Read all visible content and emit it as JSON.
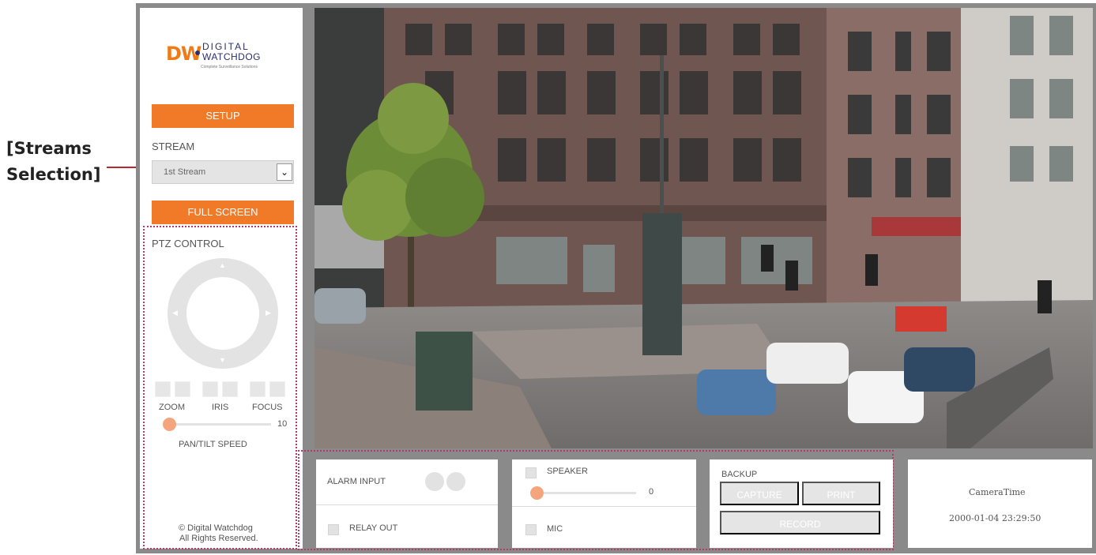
{
  "annotation": {
    "line1": "[Streams",
    "line2": "Selection]"
  },
  "logo": {
    "brand_mark": "DW",
    "name_top": "DIGITAL",
    "name_bottom": "WATCHDOG",
    "tagline": "Complete Surveillance Solutions"
  },
  "sidebar": {
    "setup_label": "SETUP",
    "stream_label": "STREAM",
    "stream_selected": "1st Stream",
    "fullscreen_label": "FULL SCREEN",
    "ptz_title": "PTZ CONTROL",
    "zoom_label": "ZOOM",
    "iris_label": "IRIS",
    "focus_label": "FOCUS",
    "speed_value": "10",
    "speed_label": "PAN/TILT SPEED",
    "copyright": "© Digital Watchdog",
    "rights": "All Rights Reserved."
  },
  "bottom": {
    "alarm_input_label": "ALARM INPUT",
    "relay_out_label": "RELAY OUT",
    "speaker_label": "SPEAKER",
    "speaker_value": "0",
    "mic_label": "MIC",
    "backup_label": "BACKUP",
    "capture_label": "CAPTURE",
    "print_label": "PRINT",
    "record_label": "RECORD",
    "camera_time_label": "CameraTime",
    "camera_time_value": "2000-01-04 23:29:50"
  },
  "colors": {
    "accent": "#f07a28",
    "slider_thumb": "#f5a57e",
    "dotted_border": "#b43a6a",
    "annotation_line": "#c0272d",
    "frame": "#8a8a8a"
  }
}
